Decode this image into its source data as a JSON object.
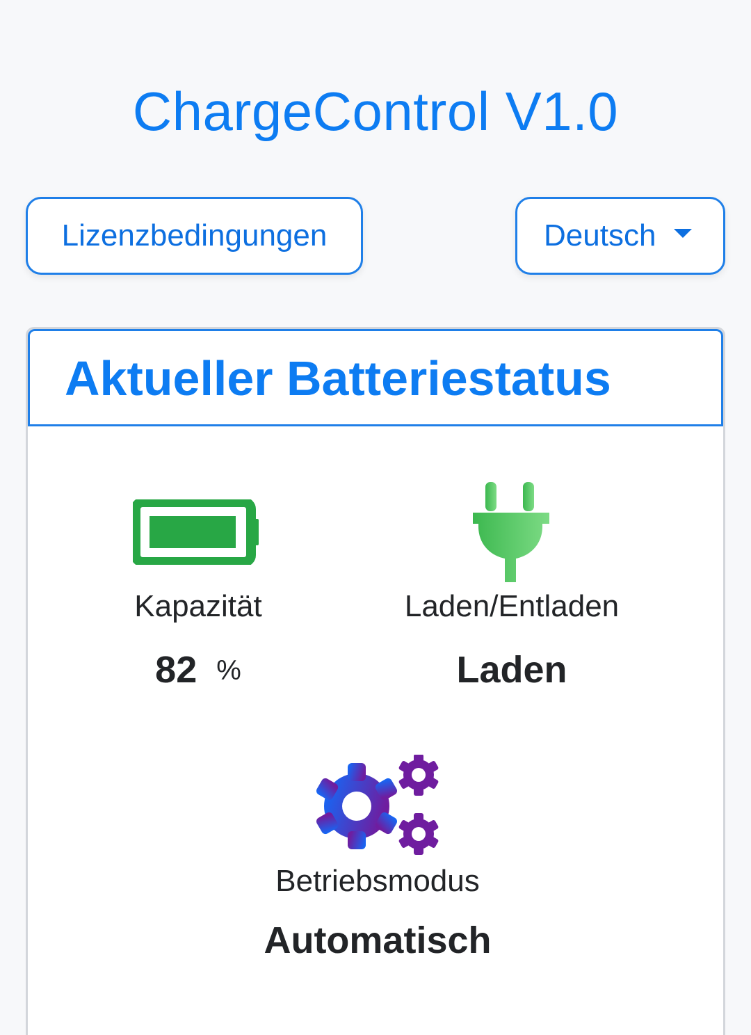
{
  "app": {
    "title": "ChargeControl V1.0"
  },
  "toolbar": {
    "license_label": "Lizenzbedingungen",
    "language_selected": "Deutsch"
  },
  "battery_card": {
    "title": "Aktueller Batteriestatus",
    "capacity": {
      "label": "Kapazität",
      "value": "82",
      "unit": "%",
      "icon": "battery-full-icon"
    },
    "charging": {
      "label": "Laden/Entladen",
      "value": "Laden",
      "icon": "plug-icon"
    },
    "mode": {
      "label": "Betriebsmodus",
      "value": "Automatisch",
      "icon": "gears-icon"
    }
  },
  "colors": {
    "accent": "#0d7cf2",
    "battery_green": "#28a745",
    "plug_green_start": "#3cb84f",
    "plug_green_end": "#7ddb85",
    "gear_blue": "#0d6efd",
    "gear_purple": "#6f1d9f"
  }
}
